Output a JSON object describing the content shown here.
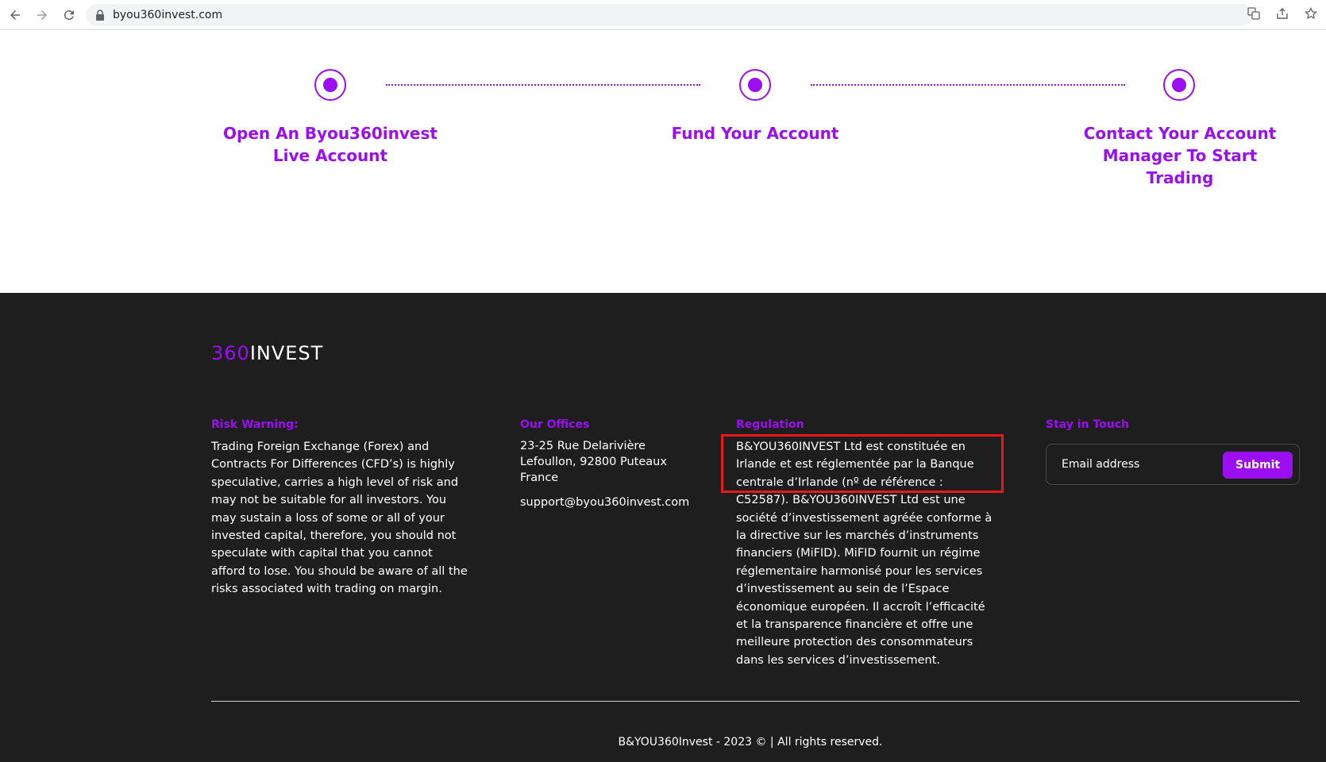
{
  "browser": {
    "url": "byou360invest.com"
  },
  "steps": [
    {
      "title": "Open An Byou360invest Live Account"
    },
    {
      "title": "Fund Your Account"
    },
    {
      "title": "Contact Your Account Manager To Start Trading"
    }
  ],
  "footer": {
    "logo_part1": "360",
    "logo_part2": "INVEST",
    "risk": {
      "heading": "Risk Warning:",
      "text": "Trading Foreign Exchange (Forex) and Contracts For Differences (CFD’s) is highly speculative, carries a high level of risk and may not be suitable for all investors. You may sustain a loss of some or all of your invested capital, therefore, you should not speculate with capital that you cannot afford to lose. You should be aware of all the risks associated with trading on margin."
    },
    "offices": {
      "heading": "Our Offices",
      "address": "23-25 Rue Delarivière Lefoullon, 92800 Puteaux France",
      "email": "support@byou360invest.com"
    },
    "regulation": {
      "heading": "Regulation",
      "text": "B&YOU360INVEST Ltd est constituée en Irlande et est réglementée par la Banque centrale d’Irlande (nº de référence : C52587). B&YOU360INVEST Ltd est une société d’investissement agréée conforme à la directive sur les marchés d’instruments financiers (MiFID). MiFID fournit un régime réglementaire harmonisé pour les services d’investissement au sein de l’Espace économique européen. Il accroît l’efficacité et la transparence financière et offre une meilleure protection des consommateurs dans les services d’investissement."
    },
    "stay": {
      "heading": "Stay in Touch",
      "placeholder": "Email address",
      "submit_label": "Submit"
    },
    "copyright": "B&YOU360Invest - 2023 © | All rights reserved."
  },
  "colors": {
    "accent": "#9b0ef0",
    "footer_bg": "#1e1e1e",
    "highlight": "#e51b1b"
  }
}
